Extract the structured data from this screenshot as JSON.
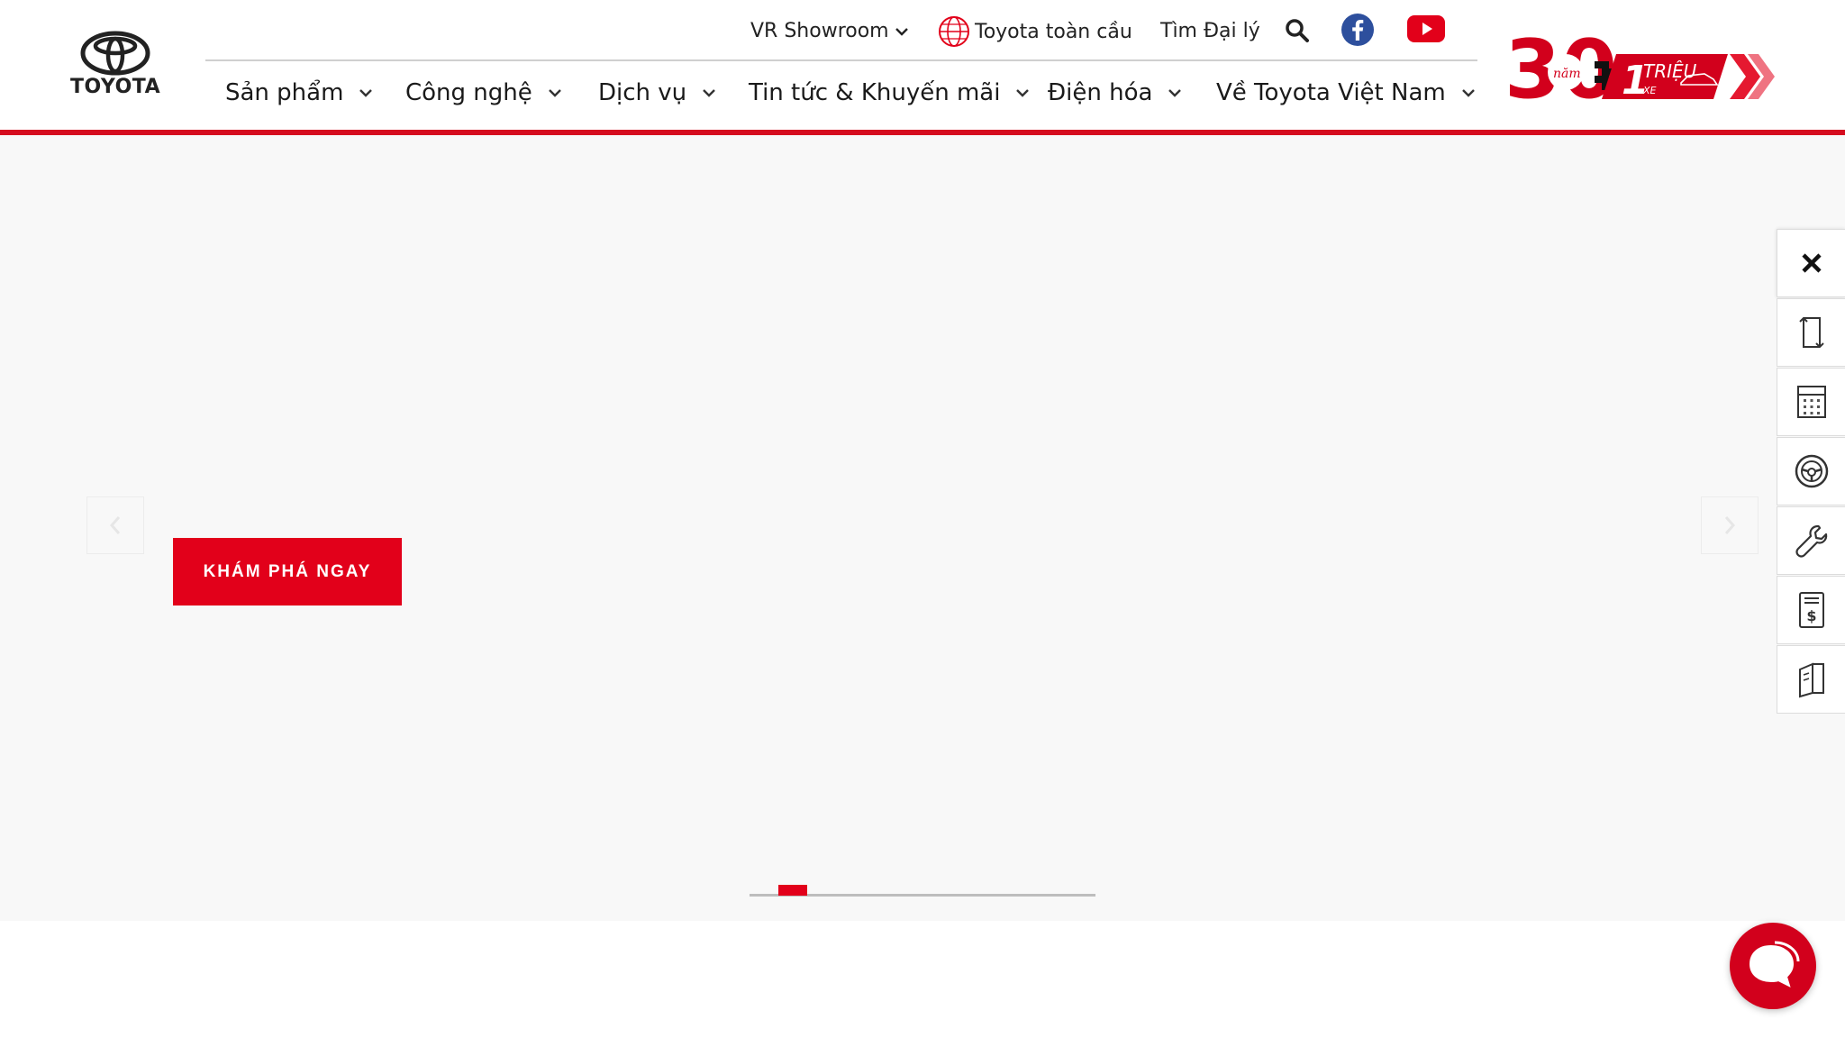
{
  "brand": {
    "name": "TOYOTA",
    "accent_color": "#e2001a",
    "header_line_color": "#d50c1f"
  },
  "topbar": {
    "vr_showroom": "VR Showroom",
    "global": "Toyota toàn cầu",
    "find_dealer": "Tìm Đại lý",
    "icons": [
      "chevron-down-icon",
      "globe-icon",
      "search-icon",
      "facebook-icon",
      "youtube-icon"
    ]
  },
  "nav": {
    "items": [
      {
        "label": "Sản phẩm"
      },
      {
        "label": "Công nghệ"
      },
      {
        "label": "Dịch vụ"
      },
      {
        "label": "Tin tức & Khuyến mãi"
      },
      {
        "label": "Điện hóa"
      },
      {
        "label": "Về Toyota Việt Nam"
      }
    ]
  },
  "badge": {
    "years": "30",
    "years_sub": "năm",
    "million": "1",
    "million_label": "TRIỆU",
    "vehicles": "XE"
  },
  "hero": {
    "cta_label": "KHÁM PHÁ NGAY",
    "slides_total": 9,
    "current_slide": 1
  },
  "side_tools": {
    "icons": [
      "close-icon",
      "compare-icon",
      "calculator-icon",
      "steering-wheel-icon",
      "wrench-icon",
      "price-list-icon",
      "brochure-icon"
    ]
  },
  "chat": {
    "icon": "chat-icon"
  }
}
